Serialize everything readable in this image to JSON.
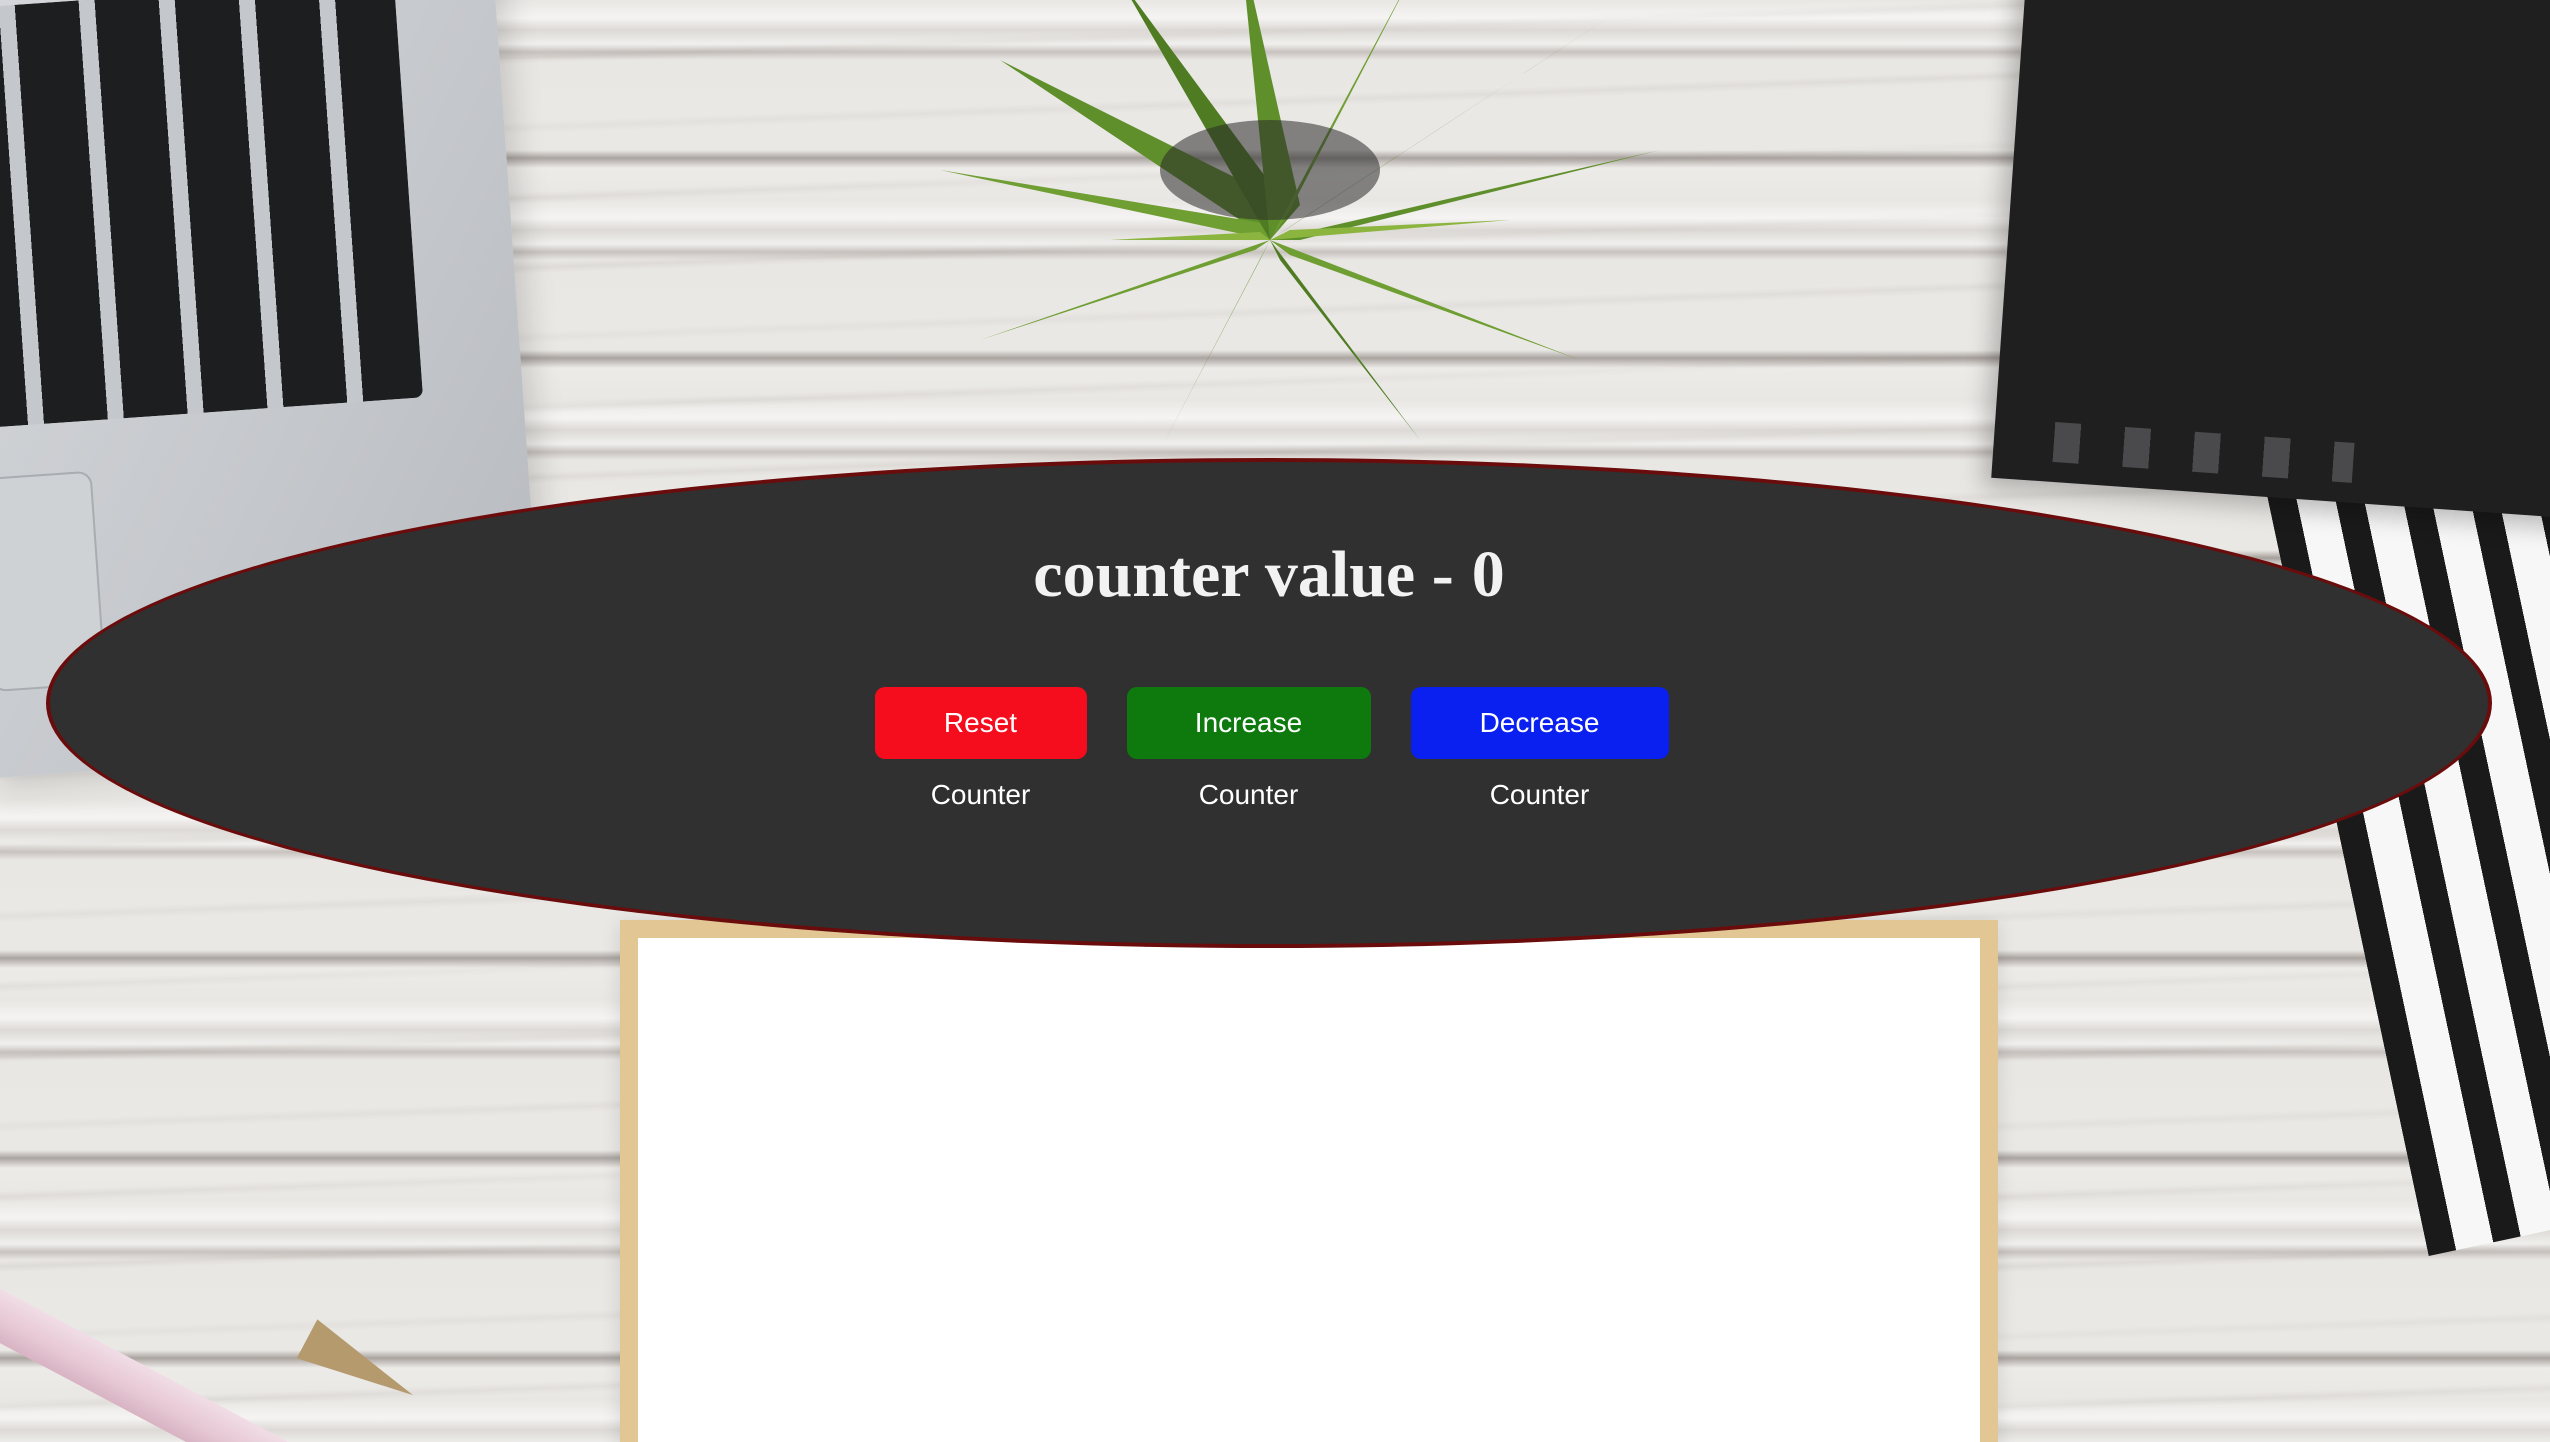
{
  "counter": {
    "label": "counter value -",
    "value": "0"
  },
  "buttons": {
    "reset": "Reset Counter",
    "increase": "Increase Counter",
    "decrease": "Decrease Counter"
  },
  "colors": {
    "card_background": "#303030",
    "card_border": "#6a0c0c",
    "reset_button": "#f50c1d",
    "increase_button": "#0e7a0e",
    "decrease_button": "#0a20f0"
  }
}
